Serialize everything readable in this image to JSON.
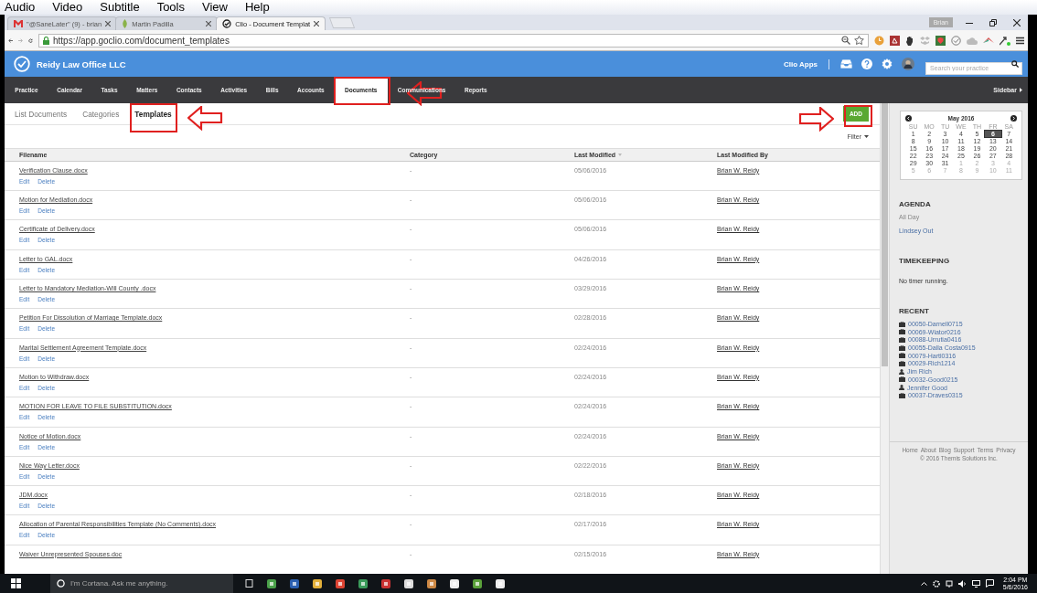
{
  "player_menu": [
    "Audio",
    "Video",
    "Subtitle",
    "Tools",
    "View",
    "Help"
  ],
  "browser": {
    "tabs": [
      {
        "title": "\"@SaneLater\" (9) - brian",
        "selected": false
      },
      {
        "title": "Martin Padilla",
        "selected": false
      },
      {
        "title": "Clio - Document Templat",
        "selected": true
      }
    ],
    "profile": "Brian",
    "url": "https://app.goclio.com/document_templates"
  },
  "header": {
    "firm": "Reidy Law Office LLC",
    "apps": "Clio Apps",
    "search": {
      "placeholder": "Search your practice"
    }
  },
  "nav": {
    "items": [
      {
        "label": "Practice",
        "selected": false
      },
      {
        "label": "Calendar",
        "selected": false
      },
      {
        "label": "Tasks",
        "selected": false
      },
      {
        "label": "Matters",
        "selected": false
      },
      {
        "label": "Contacts",
        "selected": false
      },
      {
        "label": "Activities",
        "selected": false
      },
      {
        "label": "Bills",
        "selected": false
      },
      {
        "label": "Accounts",
        "selected": false
      },
      {
        "label": "Documents",
        "selected": true
      },
      {
        "label": "Communications",
        "selected": false
      },
      {
        "label": "Reports",
        "selected": false
      }
    ],
    "sidebar": "Sidebar"
  },
  "subnav": {
    "items": [
      {
        "label": "List Documents",
        "selected": false
      },
      {
        "label": "Categories",
        "selected": false
      },
      {
        "label": "Templates",
        "selected": true
      }
    ],
    "add": "ADD"
  },
  "filter": "Filter",
  "table": {
    "columns": [
      "Filename",
      "Category",
      "Last Modified",
      "Last Modified By"
    ],
    "rows": [
      {
        "filename": "Verification Clause.docx",
        "category": "-",
        "modified": "05/06/2016",
        "by": "Brian W. Reidy",
        "actions": [
          "Edit",
          "Delete"
        ]
      },
      {
        "filename": "Motion for Mediation.docx",
        "category": "-",
        "modified": "05/06/2016",
        "by": "Brian W. Reidy",
        "actions": [
          "Edit",
          "Delete"
        ]
      },
      {
        "filename": "Certificate of Delivery.docx",
        "category": "-",
        "modified": "05/06/2016",
        "by": "Brian W. Reidy",
        "actions": [
          "Edit",
          "Delete"
        ]
      },
      {
        "filename": "Letter to GAL.docx",
        "category": "-",
        "modified": "04/26/2016",
        "by": "Brian W. Reidy",
        "actions": [
          "Edit",
          "Delete"
        ]
      },
      {
        "filename": "Letter to Mandatory Mediation-Will County .docx",
        "category": "-",
        "modified": "03/29/2016",
        "by": "Brian W. Reidy",
        "actions": [
          "Edit",
          "Delete"
        ]
      },
      {
        "filename": "Petition For Dissolution of Marriage Template.docx",
        "category": "-",
        "modified": "02/28/2016",
        "by": "Brian W. Reidy",
        "actions": [
          "Edit",
          "Delete"
        ]
      },
      {
        "filename": "Marital Settlement Agreement Template.docx",
        "category": "-",
        "modified": "02/24/2016",
        "by": "Brian W. Reidy",
        "actions": [
          "Edit",
          "Delete"
        ]
      },
      {
        "filename": "Motion to Withdraw.docx",
        "category": "-",
        "modified": "02/24/2016",
        "by": "Brian W. Reidy",
        "actions": [
          "Edit",
          "Delete"
        ]
      },
      {
        "filename": "MOTION FOR LEAVE TO FILE SUBSTITUTION.docx",
        "category": "-",
        "modified": "02/24/2016",
        "by": "Brian W. Reidy",
        "actions": [
          "Edit",
          "Delete"
        ]
      },
      {
        "filename": "Notice of Motion.docx",
        "category": "-",
        "modified": "02/24/2016",
        "by": "Brian W. Reidy",
        "actions": [
          "Edit",
          "Delete"
        ]
      },
      {
        "filename": "Nice Way Letter.docx",
        "category": "-",
        "modified": "02/22/2016",
        "by": "Brian W. Reidy",
        "actions": [
          "Edit",
          "Delete"
        ]
      },
      {
        "filename": "JDM.docx",
        "category": "-",
        "modified": "02/18/2016",
        "by": "Brian W. Reidy",
        "actions": [
          "Edit",
          "Delete"
        ]
      },
      {
        "filename": "Allocation of Parental Responsibilities Template (No Comments).docx",
        "category": "-",
        "modified": "02/17/2016",
        "by": "Brian W. Reidy",
        "actions": [
          "Edit",
          "Delete"
        ]
      },
      {
        "filename": "Waiver Unrepresented Spouses.doc",
        "category": "-",
        "modified": "02/15/2016",
        "by": "Brian W. Reidy"
      }
    ]
  },
  "sidebar": {
    "calendar": {
      "title": "May 2016",
      "weekdays": [
        "SU",
        "MO",
        "TU",
        "WE",
        "TH",
        "FR",
        "SA"
      ],
      "days": [
        {
          "day": "1",
          "other_month": false,
          "selected": false
        },
        {
          "day": "2",
          "other_month": false,
          "selected": false
        },
        {
          "day": "3",
          "other_month": false,
          "selected": false
        },
        {
          "day": "4",
          "other_month": false,
          "selected": false
        },
        {
          "day": "5",
          "other_month": false,
          "selected": false
        },
        {
          "day": "6",
          "other_month": false,
          "selected": true
        },
        {
          "day": "7",
          "other_month": false,
          "selected": false
        },
        {
          "day": "8",
          "other_month": false,
          "selected": false
        },
        {
          "day": "9",
          "other_month": false,
          "selected": false
        },
        {
          "day": "10",
          "other_month": false,
          "selected": false
        },
        {
          "day": "11",
          "other_month": false,
          "selected": false
        },
        {
          "day": "12",
          "other_month": false,
          "selected": false
        },
        {
          "day": "13",
          "other_month": false,
          "selected": false
        },
        {
          "day": "14",
          "other_month": false,
          "selected": false
        },
        {
          "day": "15",
          "other_month": false,
          "selected": false
        },
        {
          "day": "16",
          "other_month": false,
          "selected": false
        },
        {
          "day": "17",
          "other_month": false,
          "selected": false
        },
        {
          "day": "18",
          "other_month": false,
          "selected": false
        },
        {
          "day": "19",
          "other_month": false,
          "selected": false
        },
        {
          "day": "20",
          "other_month": false,
          "selected": false
        },
        {
          "day": "21",
          "other_month": false,
          "selected": false
        },
        {
          "day": "22",
          "other_month": false,
          "selected": false
        },
        {
          "day": "23",
          "other_month": false,
          "selected": false
        },
        {
          "day": "24",
          "other_month": false,
          "selected": false
        },
        {
          "day": "25",
          "other_month": false,
          "selected": false
        },
        {
          "day": "26",
          "other_month": false,
          "selected": false
        },
        {
          "day": "27",
          "other_month": false,
          "selected": false
        },
        {
          "day": "28",
          "other_month": false,
          "selected": false
        },
        {
          "day": "29",
          "other_month": false,
          "selected": false
        },
        {
          "day": "30",
          "other_month": false,
          "selected": false
        },
        {
          "day": "31",
          "other_month": false,
          "selected": false
        },
        {
          "day": "1",
          "other_month": true,
          "selected": false
        },
        {
          "day": "2",
          "other_month": true,
          "selected": false
        },
        {
          "day": "3",
          "other_month": true,
          "selected": false
        },
        {
          "day": "4",
          "other_month": true,
          "selected": false
        },
        {
          "day": "5",
          "other_month": true,
          "selected": false
        },
        {
          "day": "6",
          "other_month": true,
          "selected": false
        },
        {
          "day": "7",
          "other_month": true,
          "selected": false
        },
        {
          "day": "8",
          "other_month": true,
          "selected": false
        },
        {
          "day": "9",
          "other_month": true,
          "selected": false
        },
        {
          "day": "10",
          "other_month": true,
          "selected": false
        },
        {
          "day": "11",
          "other_month": true,
          "selected": false
        }
      ]
    },
    "agenda": {
      "heading": "AGENDA",
      "label": "All Day",
      "event": "Lindsey Out"
    },
    "timekeeping": {
      "heading": "TIMEKEEPING",
      "text": "No timer running."
    },
    "recent": {
      "heading": "RECENT",
      "items": [
        {
          "label": "00050-Darnell0715",
          "kind": "matter"
        },
        {
          "label": "00069-Wiator0216",
          "kind": "matter"
        },
        {
          "label": "00088-Urrutia0416",
          "kind": "matter"
        },
        {
          "label": "00055-Dalla Costa0915",
          "kind": "matter"
        },
        {
          "label": "00079-Hartl0316",
          "kind": "matter"
        },
        {
          "label": "00029-Rich1214",
          "kind": "matter"
        },
        {
          "label": "Jim Rich",
          "kind": "contact"
        },
        {
          "label": "00032-Good0215",
          "kind": "matter"
        },
        {
          "label": "Jennifer Good",
          "kind": "contact"
        },
        {
          "label": "00037-Draves0315",
          "kind": "matter"
        }
      ]
    },
    "footer": {
      "links": [
        "Home",
        "About",
        "Blog",
        "Support",
        "Terms",
        "Privacy"
      ],
      "copyright": "© 2016 Themis Solutions Inc."
    }
  },
  "taskbar": {
    "search": "I'm Cortana. Ask me anything.",
    "time": "2:04 PM",
    "date": "5/6/2016"
  }
}
